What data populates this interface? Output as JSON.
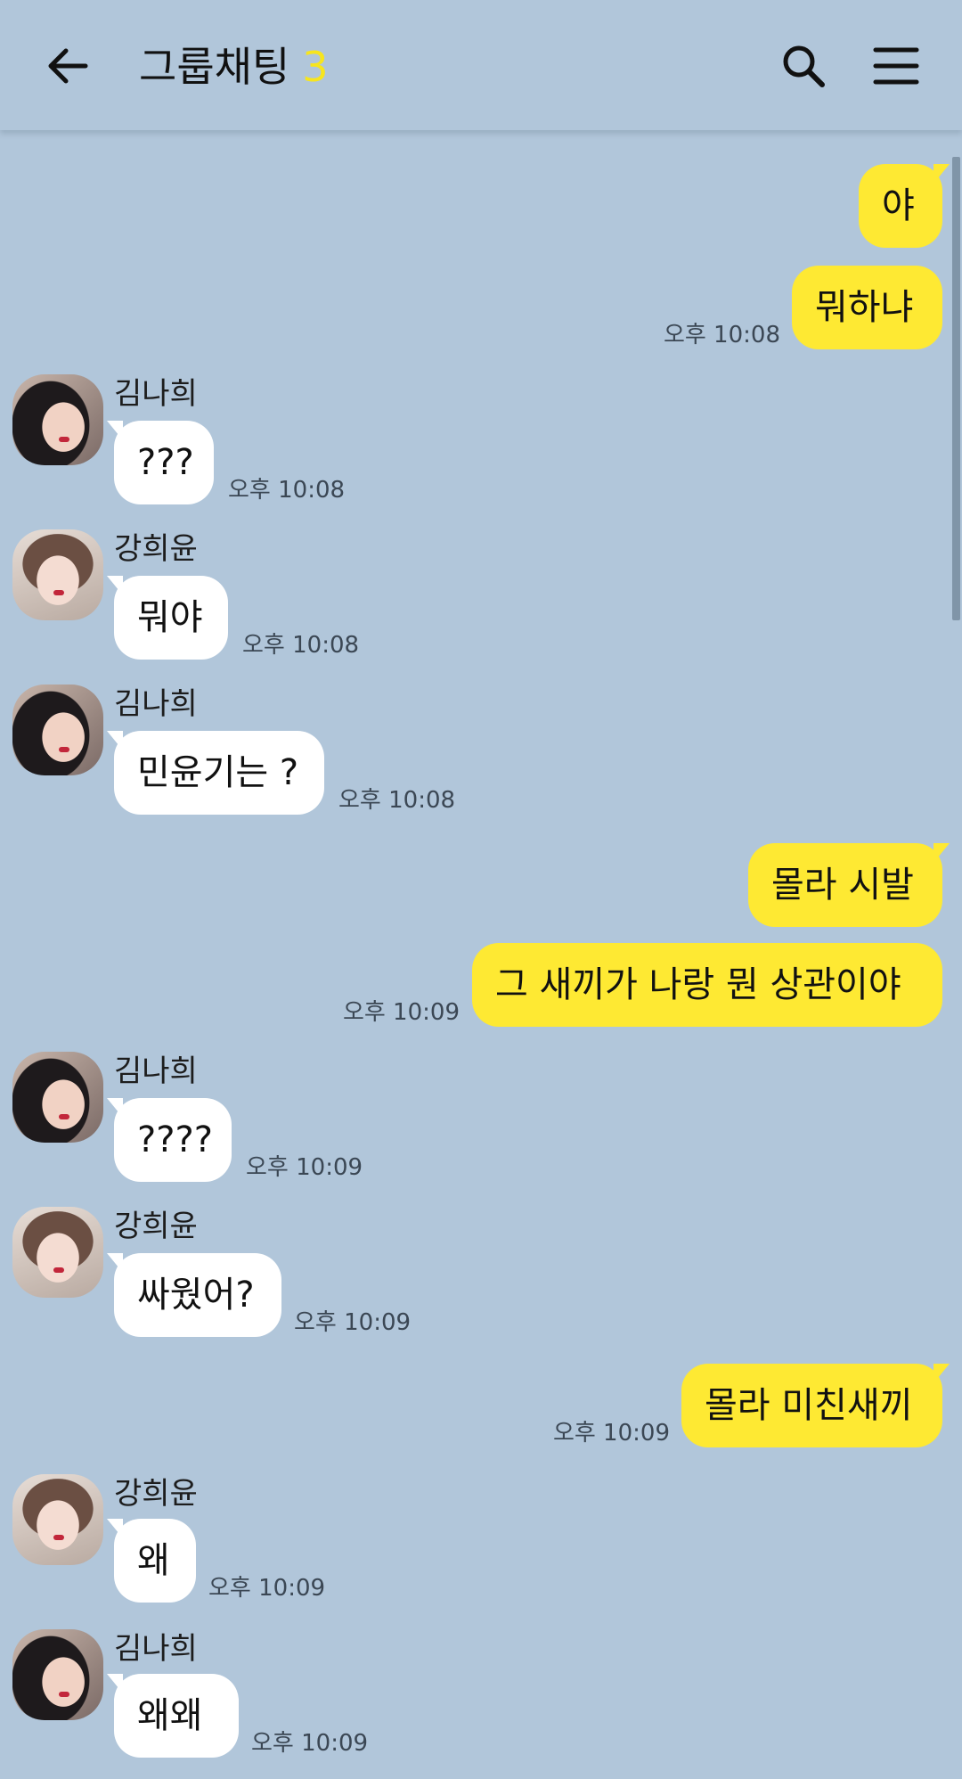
{
  "header": {
    "title": "그룹채팅",
    "member_count": "3",
    "back_icon": "arrow-left-icon",
    "search_icon": "search-icon",
    "menu_icon": "hamburger-menu-icon"
  },
  "colors": {
    "background": "#b1c6da",
    "my_bubble": "#fee933",
    "other_bubble": "#ffffff",
    "count_accent": "#f7e51e"
  },
  "messages": [
    {
      "from": "me",
      "text": "야",
      "time": ""
    },
    {
      "from": "me",
      "text": "뭐하냐",
      "time": "오후 10:08"
    },
    {
      "from": "김나희",
      "text": "???",
      "time": "오후 10:08"
    },
    {
      "from": "강희윤",
      "text": "뭐야",
      "time": "오후 10:08"
    },
    {
      "from": "김나희",
      "text": "민윤기는 ?",
      "time": "오후 10:08"
    },
    {
      "from": "me",
      "text": "몰라 시발",
      "time": ""
    },
    {
      "from": "me",
      "text": "그 새끼가 나랑 뭔 상관이야",
      "time": "오후 10:09"
    },
    {
      "from": "김나희",
      "text": "????",
      "time": "오후 10:09"
    },
    {
      "from": "강희윤",
      "text": "싸웠어?",
      "time": "오후 10:09"
    },
    {
      "from": "me",
      "text": "몰라 미친새끼",
      "time": "오후 10:09"
    },
    {
      "from": "강희윤",
      "text": "왜",
      "time": "오후 10:09"
    },
    {
      "from": "김나희",
      "text": "왜왜",
      "time": "오후 10:09"
    }
  ]
}
